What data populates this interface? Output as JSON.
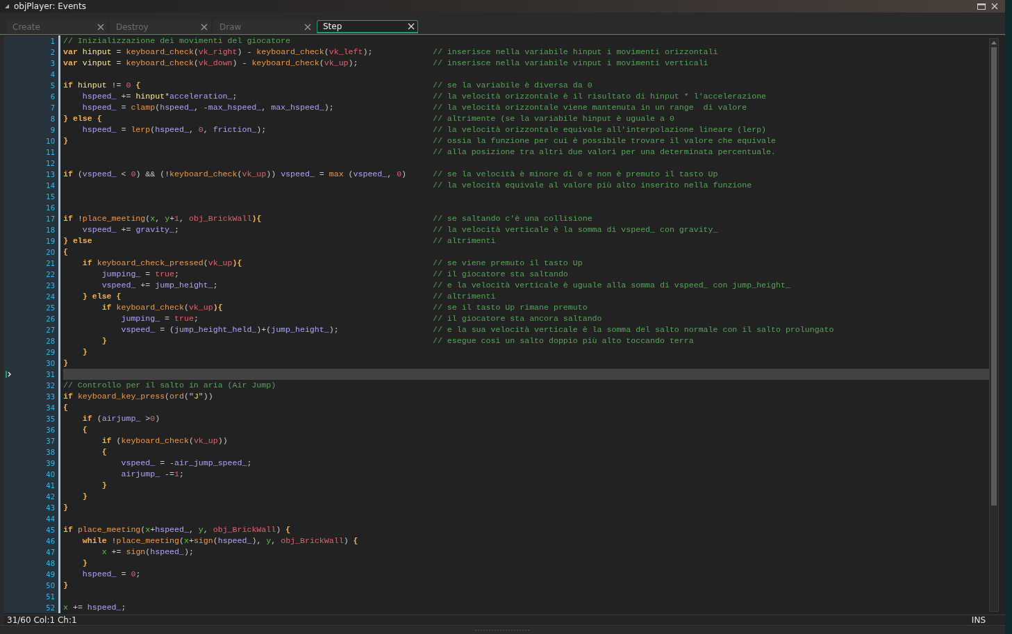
{
  "window": {
    "title": "objPlayer: Events"
  },
  "tabs": [
    {
      "label": "Create",
      "selected": false
    },
    {
      "label": "Destroy",
      "selected": false
    },
    {
      "label": "Draw",
      "selected": false
    },
    {
      "label": "Step",
      "selected": true
    }
  ],
  "editor": {
    "lines": [
      {
        "number": "1",
        "current": false,
        "tokens": [
          {
            "kind": "comment",
            "text": "// Inizializzazione dei movimenti del giocatore"
          }
        ]
      },
      {
        "number": "2",
        "current": false,
        "tokens": [
          {
            "kind": "keyword",
            "text": "var "
          },
          {
            "kind": "local",
            "text": "hinput"
          },
          {
            "kind": "plain",
            "text": " = "
          },
          {
            "kind": "function",
            "text": "keyboard_check"
          },
          {
            "kind": "plain",
            "text": "("
          },
          {
            "kind": "constant",
            "text": "vk_right"
          },
          {
            "kind": "plain",
            "text": ") - "
          },
          {
            "kind": "function",
            "text": "keyboard_check"
          },
          {
            "kind": "plain",
            "text": "("
          },
          {
            "kind": "constant",
            "text": "vk_left"
          },
          {
            "kind": "plain",
            "text": ");"
          }
        ],
        "comment": "// inserisce nella variabile hinput i movimenti orizzontali"
      },
      {
        "number": "3",
        "current": false,
        "tokens": [
          {
            "kind": "keyword",
            "text": "var "
          },
          {
            "kind": "local",
            "text": "vinput"
          },
          {
            "kind": "plain",
            "text": " = "
          },
          {
            "kind": "function",
            "text": "keyboard_check"
          },
          {
            "kind": "plain",
            "text": "("
          },
          {
            "kind": "constant",
            "text": "vk_down"
          },
          {
            "kind": "plain",
            "text": ") - "
          },
          {
            "kind": "function",
            "text": "keyboard_check"
          },
          {
            "kind": "plain",
            "text": "("
          },
          {
            "kind": "constant",
            "text": "vk_up"
          },
          {
            "kind": "plain",
            "text": ");"
          }
        ],
        "comment": "// inserisce nella variabile vinput i movimenti verticali"
      },
      {
        "number": "4",
        "current": false
      },
      {
        "number": "5",
        "current": false,
        "tokens": [
          {
            "kind": "keyword",
            "text": "if "
          },
          {
            "kind": "local",
            "text": "hinput"
          },
          {
            "kind": "plain",
            "text": " != "
          },
          {
            "kind": "constant",
            "text": "0"
          },
          {
            "kind": "keyword",
            "text": " {"
          }
        ],
        "comment": "// se la variabile è diversa da 0"
      },
      {
        "number": "6",
        "current": false,
        "tokens": [
          {
            "kind": "variable",
            "text": "    hspeed_"
          },
          {
            "kind": "plain",
            "text": " += "
          },
          {
            "kind": "local",
            "text": "hinput"
          },
          {
            "kind": "plain",
            "text": "*"
          },
          {
            "kind": "variable",
            "text": "acceleration_"
          },
          {
            "kind": "plain",
            "text": ";"
          }
        ],
        "comment": "// la velocità orizzontale è il risultato di hinput * l'accelerazione"
      },
      {
        "number": "7",
        "current": false,
        "tokens": [
          {
            "kind": "variable",
            "text": "    hspeed_"
          },
          {
            "kind": "plain",
            "text": " = "
          },
          {
            "kind": "function",
            "text": "clamp"
          },
          {
            "kind": "plain",
            "text": "("
          },
          {
            "kind": "variable",
            "text": "hspeed_"
          },
          {
            "kind": "plain",
            "text": ", -"
          },
          {
            "kind": "variable",
            "text": "max_hspeed_"
          },
          {
            "kind": "plain",
            "text": ", "
          },
          {
            "kind": "variable",
            "text": "max_hspeed_"
          },
          {
            "kind": "plain",
            "text": ");"
          }
        ],
        "comment": "// la velocità orizzontale viene mantenuta in un range  di valore"
      },
      {
        "number": "8",
        "current": false,
        "tokens": [
          {
            "kind": "keyword",
            "text": "} else {"
          }
        ],
        "comment": "// altrimente (se la variabile hinput è uguale a 0"
      },
      {
        "number": "9",
        "current": false,
        "tokens": [
          {
            "kind": "variable",
            "text": "    hspeed_"
          },
          {
            "kind": "plain",
            "text": " = "
          },
          {
            "kind": "function",
            "text": "lerp"
          },
          {
            "kind": "plain",
            "text": "("
          },
          {
            "kind": "variable",
            "text": "hspeed_"
          },
          {
            "kind": "plain",
            "text": ", "
          },
          {
            "kind": "constant",
            "text": "0"
          },
          {
            "kind": "plain",
            "text": ", "
          },
          {
            "kind": "variable",
            "text": "friction_"
          },
          {
            "kind": "plain",
            "text": ");"
          }
        ],
        "comment": "// la velocità orizzontale equivale all'interpolazione lineare (lerp)"
      },
      {
        "number": "10",
        "current": false,
        "tokens": [
          {
            "kind": "keyword",
            "text": "}"
          }
        ],
        "comment": "// ossia la funzione per cui è possibile trovare il valore che equivale"
      },
      {
        "number": "11",
        "current": false,
        "comment": "// alla posizione tra altri due valori per una determinata percentuale."
      },
      {
        "number": "12",
        "current": false
      },
      {
        "number": "13",
        "current": false,
        "tokens": [
          {
            "kind": "keyword",
            "text": "if "
          },
          {
            "kind": "plain",
            "text": "("
          },
          {
            "kind": "variable",
            "text": "vspeed_"
          },
          {
            "kind": "plain",
            "text": " < "
          },
          {
            "kind": "constant",
            "text": "0"
          },
          {
            "kind": "plain",
            "text": ") && (!"
          },
          {
            "kind": "function",
            "text": "keyboard_check"
          },
          {
            "kind": "plain",
            "text": "("
          },
          {
            "kind": "constant",
            "text": "vk_up"
          },
          {
            "kind": "plain",
            "text": ")) "
          },
          {
            "kind": "variable",
            "text": "vspeed_"
          },
          {
            "kind": "plain",
            "text": " = "
          },
          {
            "kind": "function",
            "text": "max"
          },
          {
            "kind": "plain",
            "text": " ("
          },
          {
            "kind": "variable",
            "text": "vspeed_"
          },
          {
            "kind": "plain",
            "text": ", "
          },
          {
            "kind": "constant",
            "text": "0"
          },
          {
            "kind": "plain",
            "text": ")"
          }
        ],
        "comment": "// se la velocità è minore di 0 e non è premuto il tasto Up"
      },
      {
        "number": "14",
        "current": false,
        "comment": "// la velocità equivale al valore più alto inserito nella funzione"
      },
      {
        "number": "15",
        "current": false
      },
      {
        "number": "16",
        "current": false
      },
      {
        "number": "17",
        "current": false,
        "tokens": [
          {
            "kind": "keyword",
            "text": "if "
          },
          {
            "kind": "plain",
            "text": "!"
          },
          {
            "kind": "function",
            "text": "place_meeting"
          },
          {
            "kind": "plain",
            "text": "("
          },
          {
            "kind": "builtin",
            "text": "x"
          },
          {
            "kind": "plain",
            "text": ", "
          },
          {
            "kind": "builtin",
            "text": "y"
          },
          {
            "kind": "plain",
            "text": "+"
          },
          {
            "kind": "constant",
            "text": "1"
          },
          {
            "kind": "plain",
            "text": ", "
          },
          {
            "kind": "constant",
            "text": "obj_BrickWall"
          },
          {
            "kind": "keyword",
            "text": "){"
          }
        ],
        "comment": "// se saltando c'è una collisione"
      },
      {
        "number": "18",
        "current": false,
        "tokens": [
          {
            "kind": "variable",
            "text": "    vspeed_"
          },
          {
            "kind": "plain",
            "text": " += "
          },
          {
            "kind": "variable",
            "text": "gravity_"
          },
          {
            "kind": "plain",
            "text": ";"
          }
        ],
        "comment": "// la velocità verticale è la somma di vspeed_ con gravity_"
      },
      {
        "number": "19",
        "current": false,
        "tokens": [
          {
            "kind": "keyword",
            "text": "} else"
          }
        ],
        "comment": "// altrimenti"
      },
      {
        "number": "20",
        "current": false,
        "tokens": [
          {
            "kind": "keyword",
            "text": "{"
          }
        ]
      },
      {
        "number": "21",
        "current": false,
        "tokens": [
          {
            "kind": "keyword",
            "text": "    if "
          },
          {
            "kind": "function",
            "text": "keyboard_check_pressed"
          },
          {
            "kind": "plain",
            "text": "("
          },
          {
            "kind": "constant",
            "text": "vk_up"
          },
          {
            "kind": "keyword",
            "text": "){"
          }
        ],
        "comment": "// se viene premuto il tasto Up"
      },
      {
        "number": "22",
        "current": false,
        "tokens": [
          {
            "kind": "variable",
            "text": "        jumping_"
          },
          {
            "kind": "plain",
            "text": " = "
          },
          {
            "kind": "constant",
            "text": "true"
          },
          {
            "kind": "plain",
            "text": ";"
          }
        ],
        "comment": "// il giocatore sta saltando"
      },
      {
        "number": "23",
        "current": false,
        "tokens": [
          {
            "kind": "variable",
            "text": "        vspeed_"
          },
          {
            "kind": "plain",
            "text": " += "
          },
          {
            "kind": "variable",
            "text": "jump_height_"
          },
          {
            "kind": "plain",
            "text": ";"
          }
        ],
        "comment": "// e la velocità verticale è uguale alla somma di vspeed_ con jump_height_"
      },
      {
        "number": "24",
        "current": false,
        "tokens": [
          {
            "kind": "keyword",
            "text": "    } else {"
          }
        ],
        "comment": "// altrimenti"
      },
      {
        "number": "25",
        "current": false,
        "tokens": [
          {
            "kind": "keyword",
            "text": "        if "
          },
          {
            "kind": "function",
            "text": "keyboard_check"
          },
          {
            "kind": "plain",
            "text": "("
          },
          {
            "kind": "constant",
            "text": "vk_up"
          },
          {
            "kind": "keyword",
            "text": "){"
          }
        ],
        "comment": "// se il tasto Up rimane premuto"
      },
      {
        "number": "26",
        "current": false,
        "tokens": [
          {
            "kind": "variable",
            "text": "            jumping_"
          },
          {
            "kind": "plain",
            "text": " = "
          },
          {
            "kind": "constant",
            "text": "true"
          },
          {
            "kind": "plain",
            "text": ";"
          }
        ],
        "comment": "// il giocatore sta ancora saltando"
      },
      {
        "number": "27",
        "current": false,
        "tokens": [
          {
            "kind": "variable",
            "text": "            vspeed_"
          },
          {
            "kind": "plain",
            "text": " = ("
          },
          {
            "kind": "variable",
            "text": "jump_height_held_"
          },
          {
            "kind": "plain",
            "text": ")+("
          },
          {
            "kind": "variable",
            "text": "jump_height_"
          },
          {
            "kind": "plain",
            "text": ");"
          }
        ],
        "comment": "// e la sua velocità verticale è la somma del salto normale con il salto prolungato"
      },
      {
        "number": "28",
        "current": false,
        "tokens": [
          {
            "kind": "keyword",
            "text": "        }"
          }
        ],
        "comment": "// esegue così un salto doppio più alto toccando terra"
      },
      {
        "number": "29",
        "current": false,
        "tokens": [
          {
            "kind": "keyword",
            "text": "    }"
          }
        ]
      },
      {
        "number": "30",
        "current": false,
        "tokens": [
          {
            "kind": "keyword",
            "text": "}"
          }
        ]
      },
      {
        "number": "31",
        "current": true
      },
      {
        "number": "32",
        "current": false,
        "tokens": [
          {
            "kind": "comment",
            "text": "// Controllo per il salto in aria (Air Jump)"
          }
        ]
      },
      {
        "number": "33",
        "current": false,
        "tokens": [
          {
            "kind": "keyword",
            "text": "if "
          },
          {
            "kind": "function",
            "text": "keyboard_key_press"
          },
          {
            "kind": "plain",
            "text": "("
          },
          {
            "kind": "function",
            "text": "ord"
          },
          {
            "kind": "plain",
            "text": "(\""
          },
          {
            "kind": "string",
            "text": "J"
          },
          {
            "kind": "plain",
            "text": "\"))"
          }
        ]
      },
      {
        "number": "34",
        "current": false,
        "tokens": [
          {
            "kind": "keyword",
            "text": "{"
          }
        ]
      },
      {
        "number": "35",
        "current": false,
        "tokens": [
          {
            "kind": "keyword",
            "text": "    if "
          },
          {
            "kind": "plain",
            "text": "("
          },
          {
            "kind": "variable",
            "text": "airjump_"
          },
          {
            "kind": "plain",
            "text": " >"
          },
          {
            "kind": "constant",
            "text": "0"
          },
          {
            "kind": "plain",
            "text": ")"
          }
        ]
      },
      {
        "number": "36",
        "current": false,
        "tokens": [
          {
            "kind": "keyword",
            "text": "    {"
          }
        ]
      },
      {
        "number": "37",
        "current": false,
        "tokens": [
          {
            "kind": "keyword",
            "text": "        if "
          },
          {
            "kind": "plain",
            "text": "("
          },
          {
            "kind": "function",
            "text": "keyboard_check"
          },
          {
            "kind": "plain",
            "text": "("
          },
          {
            "kind": "constant",
            "text": "vk_up"
          },
          {
            "kind": "plain",
            "text": "))"
          }
        ]
      },
      {
        "number": "38",
        "current": false,
        "tokens": [
          {
            "kind": "keyword",
            "text": "        {"
          }
        ]
      },
      {
        "number": "39",
        "current": false,
        "tokens": [
          {
            "kind": "variable",
            "text": "            vspeed_"
          },
          {
            "kind": "plain",
            "text": " = -"
          },
          {
            "kind": "variable",
            "text": "air_jump_speed_"
          },
          {
            "kind": "plain",
            "text": ";"
          }
        ]
      },
      {
        "number": "40",
        "current": false,
        "tokens": [
          {
            "kind": "variable",
            "text": "            airjump_"
          },
          {
            "kind": "plain",
            "text": " -="
          },
          {
            "kind": "constant",
            "text": "1"
          },
          {
            "kind": "plain",
            "text": ";"
          }
        ]
      },
      {
        "number": "41",
        "current": false,
        "tokens": [
          {
            "kind": "keyword",
            "text": "        }"
          }
        ]
      },
      {
        "number": "42",
        "current": false,
        "tokens": [
          {
            "kind": "keyword",
            "text": "    }"
          }
        ]
      },
      {
        "number": "43",
        "current": false,
        "tokens": [
          {
            "kind": "keyword",
            "text": "}"
          }
        ]
      },
      {
        "number": "44",
        "current": false
      },
      {
        "number": "45",
        "current": false,
        "tokens": [
          {
            "kind": "keyword",
            "text": "if "
          },
          {
            "kind": "function",
            "text": "place_meeting"
          },
          {
            "kind": "plain",
            "text": "("
          },
          {
            "kind": "builtin",
            "text": "x"
          },
          {
            "kind": "plain",
            "text": "+"
          },
          {
            "kind": "variable",
            "text": "hspeed_"
          },
          {
            "kind": "plain",
            "text": ", "
          },
          {
            "kind": "builtin",
            "text": "y"
          },
          {
            "kind": "plain",
            "text": ", "
          },
          {
            "kind": "constant",
            "text": "obj_BrickWall"
          },
          {
            "kind": "plain",
            "text": ") "
          },
          {
            "kind": "keyword",
            "text": "{"
          }
        ]
      },
      {
        "number": "46",
        "current": false,
        "tokens": [
          {
            "kind": "keyword",
            "text": "    while "
          },
          {
            "kind": "plain",
            "text": "!"
          },
          {
            "kind": "function",
            "text": "place_meeting"
          },
          {
            "kind": "plain",
            "text": "("
          },
          {
            "kind": "builtin",
            "text": "x"
          },
          {
            "kind": "plain",
            "text": "+"
          },
          {
            "kind": "function",
            "text": "sign"
          },
          {
            "kind": "plain",
            "text": "("
          },
          {
            "kind": "variable",
            "text": "hspeed_"
          },
          {
            "kind": "plain",
            "text": "), "
          },
          {
            "kind": "builtin",
            "text": "y"
          },
          {
            "kind": "plain",
            "text": ", "
          },
          {
            "kind": "constant",
            "text": "obj_BrickWall"
          },
          {
            "kind": "plain",
            "text": ") "
          },
          {
            "kind": "keyword",
            "text": "{"
          }
        ]
      },
      {
        "number": "47",
        "current": false,
        "tokens": [
          {
            "kind": "builtin",
            "text": "        x"
          },
          {
            "kind": "plain",
            "text": " += "
          },
          {
            "kind": "function",
            "text": "sign"
          },
          {
            "kind": "plain",
            "text": "("
          },
          {
            "kind": "variable",
            "text": "hspeed_"
          },
          {
            "kind": "plain",
            "text": ");"
          }
        ]
      },
      {
        "number": "48",
        "current": false,
        "tokens": [
          {
            "kind": "keyword",
            "text": "    }"
          }
        ]
      },
      {
        "number": "49",
        "current": false,
        "tokens": [
          {
            "kind": "variable",
            "text": "    hspeed_"
          },
          {
            "kind": "plain",
            "text": " = "
          },
          {
            "kind": "constant",
            "text": "0"
          },
          {
            "kind": "plain",
            "text": ";"
          }
        ]
      },
      {
        "number": "50",
        "current": false,
        "tokens": [
          {
            "kind": "keyword",
            "text": "}"
          }
        ]
      },
      {
        "number": "51",
        "current": false
      },
      {
        "number": "52",
        "current": false,
        "tokens": [
          {
            "kind": "builtin",
            "text": "x"
          },
          {
            "kind": "plain",
            "text": " += "
          },
          {
            "kind": "variable",
            "text": "hspeed_"
          },
          {
            "kind": "plain",
            "text": ";"
          }
        ]
      }
    ]
  },
  "status_bar": {
    "position": "31/60 Col:1 Ch:1",
    "mode": "INS"
  }
}
